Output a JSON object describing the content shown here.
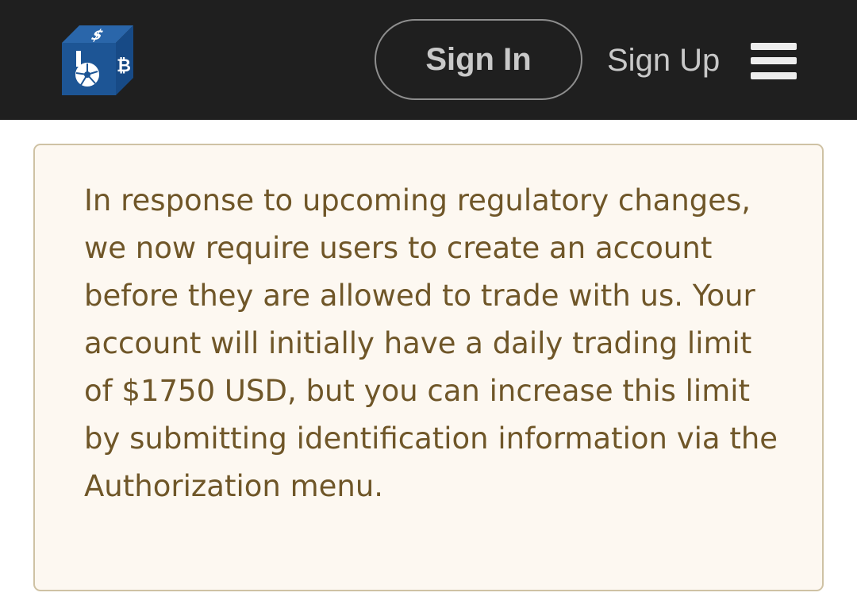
{
  "header": {
    "logo_name": "bitshares-cube-logo",
    "sign_in_label": "Sign In",
    "sign_up_label": "Sign Up",
    "menu_icon": "hamburger-menu-icon"
  },
  "notice": {
    "text": "In response to upcoming regulatory changes, we now require users to create an account before they are allowed to trade with us. Your account will initially have a daily trading limit of $1750 USD, but you can increase this limit by submitting identification information via the Authorization menu."
  },
  "colors": {
    "header_bg": "#1f1f1f",
    "notice_bg": "#fdf8f1",
    "notice_border": "#cfc2a4",
    "notice_text": "#6f5628",
    "logo_blue": "#1d5595"
  }
}
